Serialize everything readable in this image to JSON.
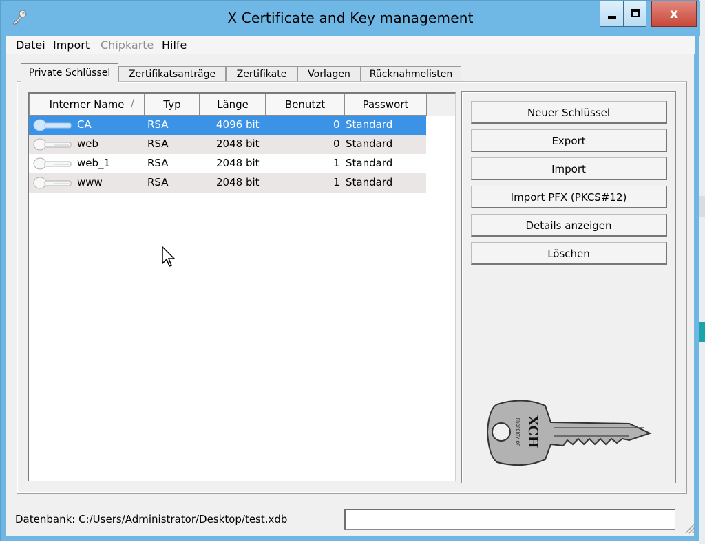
{
  "window": {
    "title": "X Certificate and Key management",
    "close_label": "x"
  },
  "menu": [
    "Datei",
    "Import",
    "Chipkarte",
    "Hilfe"
  ],
  "tabs": [
    "Private Schlüssel",
    "Zertifikatsanträge",
    "Zertifikate",
    "Vorlagen",
    "Rücknahmelisten"
  ],
  "table": {
    "columns": [
      "Interner Name",
      "Typ",
      "Länge",
      "Benutzt",
      "Passwort"
    ],
    "sort_indicator": "/",
    "rows": [
      {
        "name": "CA",
        "type": "RSA",
        "length": "4096 bit",
        "used": "0",
        "password": "Standard"
      },
      {
        "name": "web",
        "type": "RSA",
        "length": "2048 bit",
        "used": "0",
        "password": "Standard"
      },
      {
        "name": "web_1",
        "type": "RSA",
        "length": "2048 bit",
        "used": "1",
        "password": "Standard"
      },
      {
        "name": "www",
        "type": "RSA",
        "length": "2048 bit",
        "used": "1",
        "password": "Standard"
      }
    ]
  },
  "buttons": [
    "Neuer Schlüssel",
    "Export",
    "Import",
    "Import PFX (PKCS#12)",
    "Details anzeigen",
    "Löschen"
  ],
  "key_logo": {
    "brand": "XCH",
    "small_text": "PROPERTY OF"
  },
  "status": {
    "database": "Datenbank: C:/Users/Administrator/Desktop/test.xdb"
  },
  "colors": {
    "titlebar": "#6fb8e6",
    "selection": "#3a93e6",
    "close": "#c7493a"
  },
  "icons": {
    "app": "key-icon",
    "row": "key-icon",
    "cursor": "mouse-pointer-icon"
  }
}
